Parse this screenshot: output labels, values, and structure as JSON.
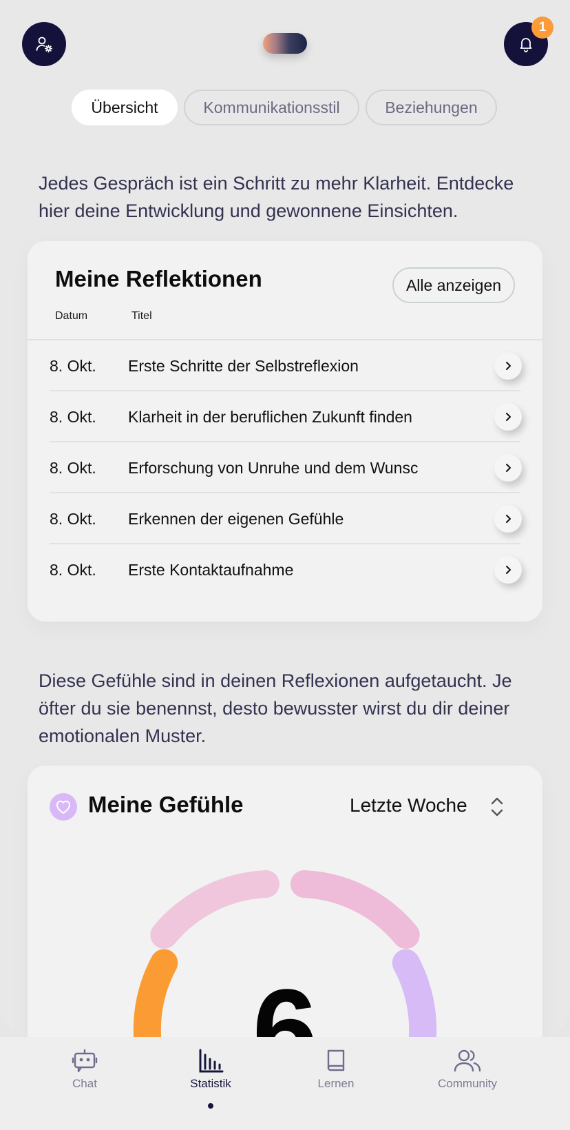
{
  "header": {
    "notification_count": "1",
    "profile_icon": "user-settings-icon",
    "bell_icon": "bell-icon"
  },
  "tabs": [
    {
      "label": "Übersicht",
      "active": true
    },
    {
      "label": "Kommunikationsstil",
      "active": false
    },
    {
      "label": "Beziehungen",
      "active": false
    }
  ],
  "intro_reflections": "Jedes Gespräch ist ein Schritt zu mehr Klarheit. Entdecke hier deine Entwicklung und gewonnene Einsichten.",
  "reflections": {
    "title": "Meine Reflektionen",
    "show_all_label": "Alle anzeigen",
    "columns": [
      "Datum",
      "Titel"
    ],
    "rows": [
      {
        "date": "8. Okt.",
        "title": "Erste Schritte der Selbstreflexion"
      },
      {
        "date": "8. Okt.",
        "title": "Klarheit in der beruflichen Zukunft finden"
      },
      {
        "date": "8. Okt.",
        "title": "Erforschung von Unruhe und dem Wunsc"
      },
      {
        "date": "8. Okt.",
        "title": "Erkennen der eigenen Gefühle"
      },
      {
        "date": "8. Okt.",
        "title": "Erste Kontaktaufnahme"
      }
    ]
  },
  "intro_feelings": "Diese Gefühle sind in deinen Reflexionen aufgetaucht. Je öfter du sie benennst, desto bewusster wirst du dir deiner emotionalen Muster.",
  "feelings": {
    "title": "Meine Gefühle",
    "period": "Letzte Woche",
    "total": "6",
    "colors": {
      "orange": "#fb9b34",
      "pink_light": "#f0c6dd",
      "pink": "#eebbd8",
      "lavender": "#d7bbf6"
    }
  },
  "nav": [
    {
      "label": "Chat",
      "icon": "chat-bot-icon",
      "active": false
    },
    {
      "label": "Statistik",
      "icon": "bar-chart-icon",
      "active": true
    },
    {
      "label": "Lernen",
      "icon": "book-icon",
      "active": false
    },
    {
      "label": "Community",
      "icon": "users-icon",
      "active": false
    }
  ]
}
